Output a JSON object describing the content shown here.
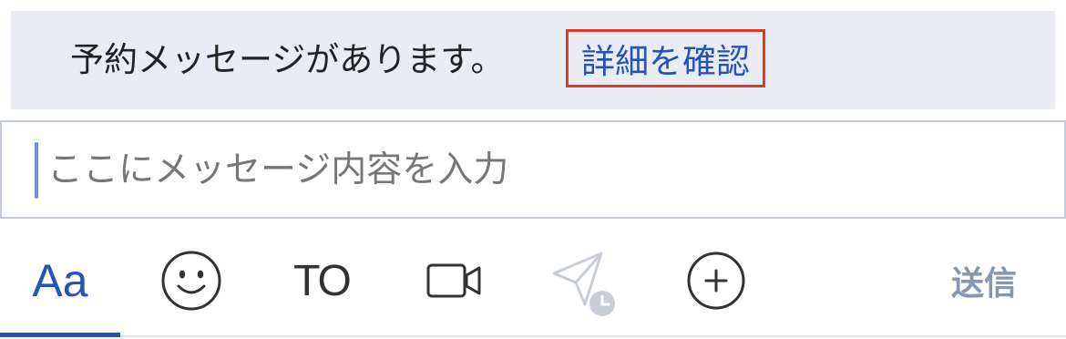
{
  "banner": {
    "message": "予約メッセージがあります。",
    "link_label": "詳細を確認"
  },
  "composer": {
    "placeholder": "ここにメッセージ内容を入力",
    "value": ""
  },
  "toolbar": {
    "format_label": "Aa",
    "emoji_icon": "smiley-icon",
    "mention_label": "TO",
    "video_icon": "video-camera-icon",
    "schedule_icon": "paper-plane-clock-icon",
    "attach_icon": "plus-circle-icon",
    "send_label": "送信"
  },
  "colors": {
    "accent": "#2354b8",
    "banner_bg": "#e9edf3",
    "highlight_border": "#e3391d",
    "send_disabled": "#8797b0"
  }
}
